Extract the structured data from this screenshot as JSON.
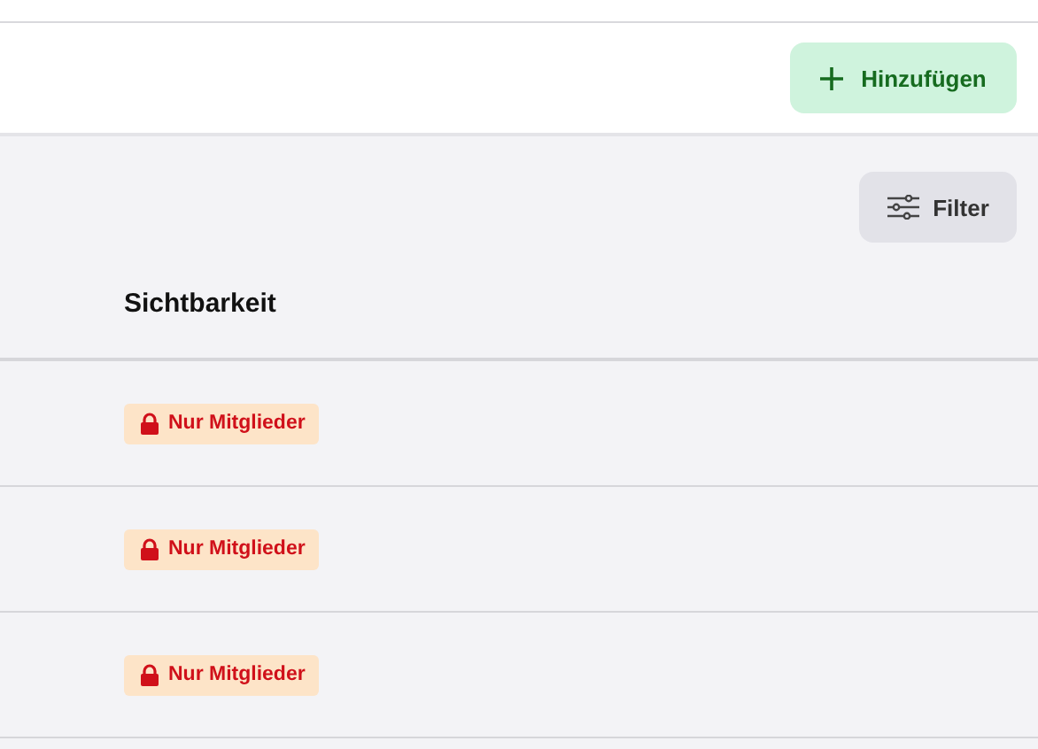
{
  "toolbar": {
    "add_button": "Hinzufügen"
  },
  "filter_button": "Filter",
  "table": {
    "columns": [
      "Sichtbarkeit"
    ],
    "rows": [
      {
        "visibility": {
          "kind": "members",
          "label": "Nur Mitglieder"
        }
      },
      {
        "visibility": {
          "kind": "members",
          "label": "Nur Mitglieder"
        }
      },
      {
        "visibility": {
          "kind": "members",
          "label": "Nur Mitglieder"
        }
      }
    ]
  }
}
